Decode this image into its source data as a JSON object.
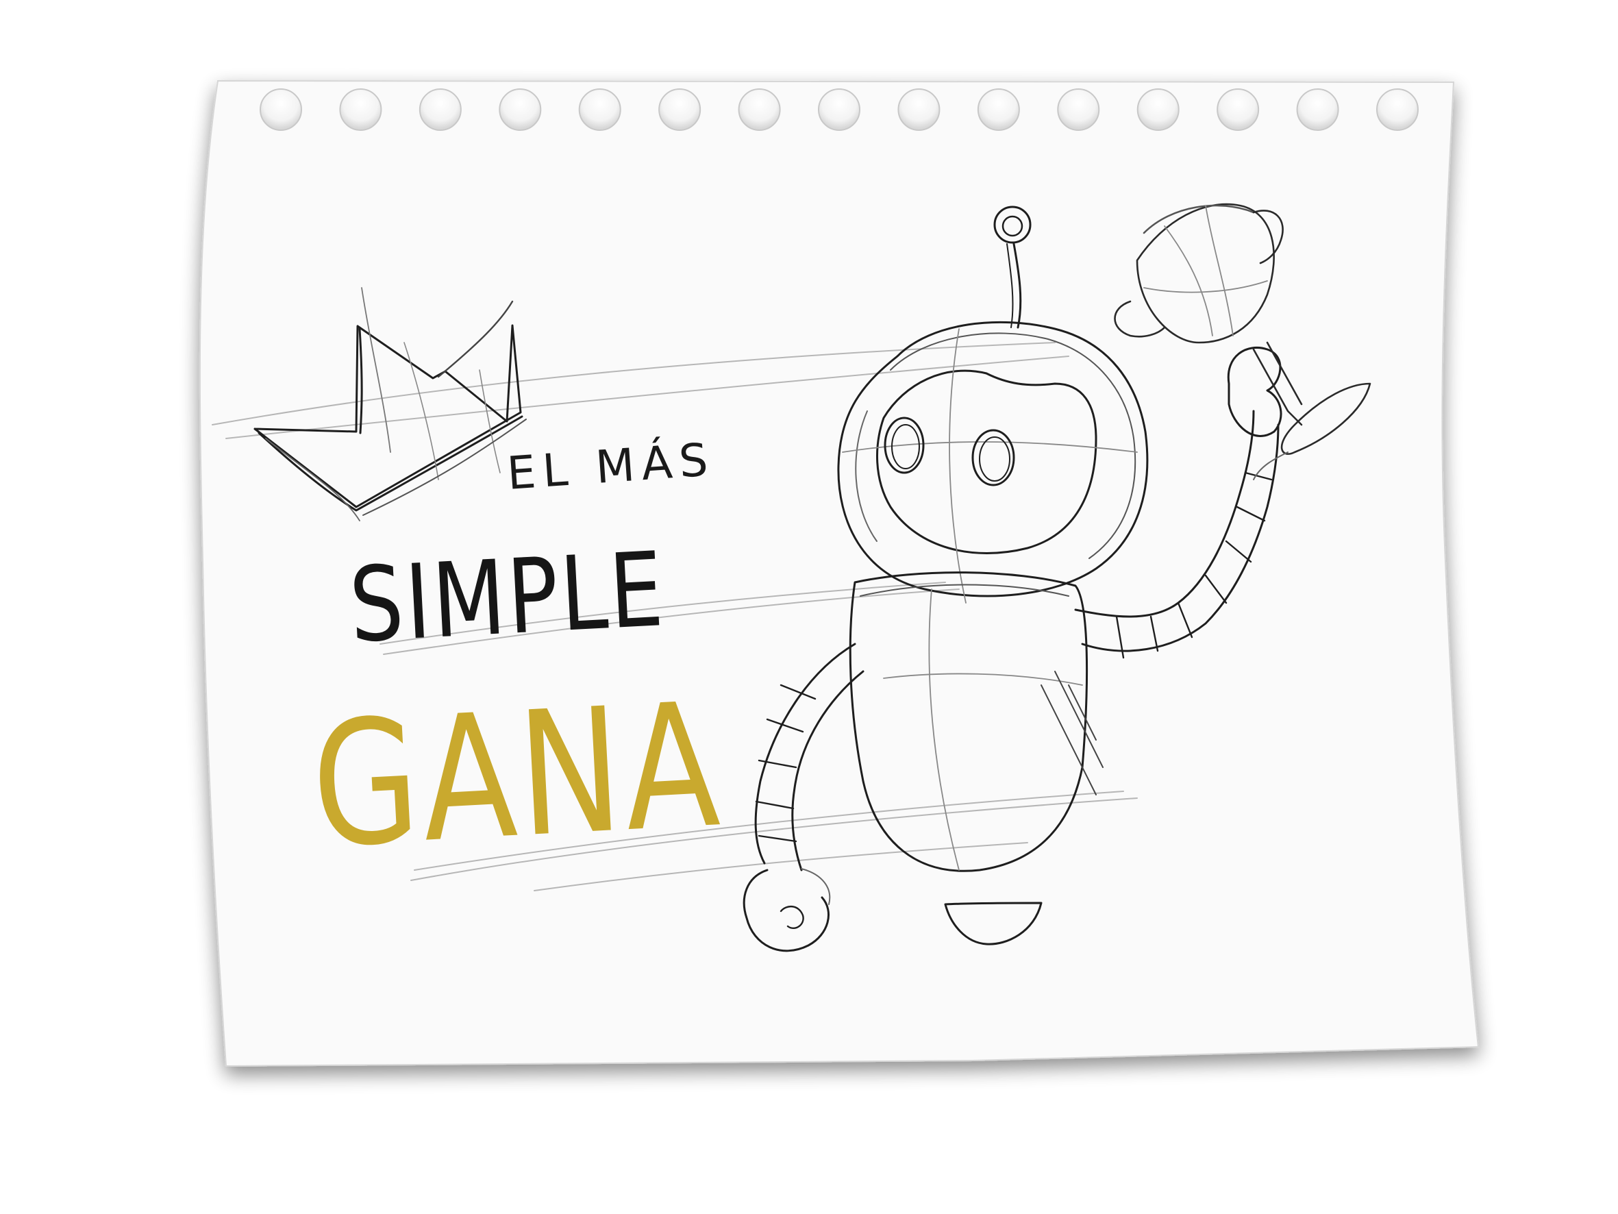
{
  "headline": {
    "line1": "EL MÁS",
    "line2": "SIMPLE",
    "line3": "GANA"
  },
  "colors": {
    "background": "#ffffff",
    "paper": "#fafafa",
    "paper_shadow": "#9a9a9a",
    "pencil": "#1e1e1e",
    "pencil_light": "#8a8a8a",
    "ink_dark": "#161616",
    "accent_gold": "#c9a92e",
    "hole_fill": "#ededed"
  },
  "illustration": {
    "paper_icon": "torn-notepad-sheet-icon",
    "hole_icon": "binder-hole-icon",
    "crown_icon": "crown-icon",
    "robot_icon": "robot-icon",
    "trophy_icon": "trophy-icon",
    "binder_hole_count": 15
  }
}
